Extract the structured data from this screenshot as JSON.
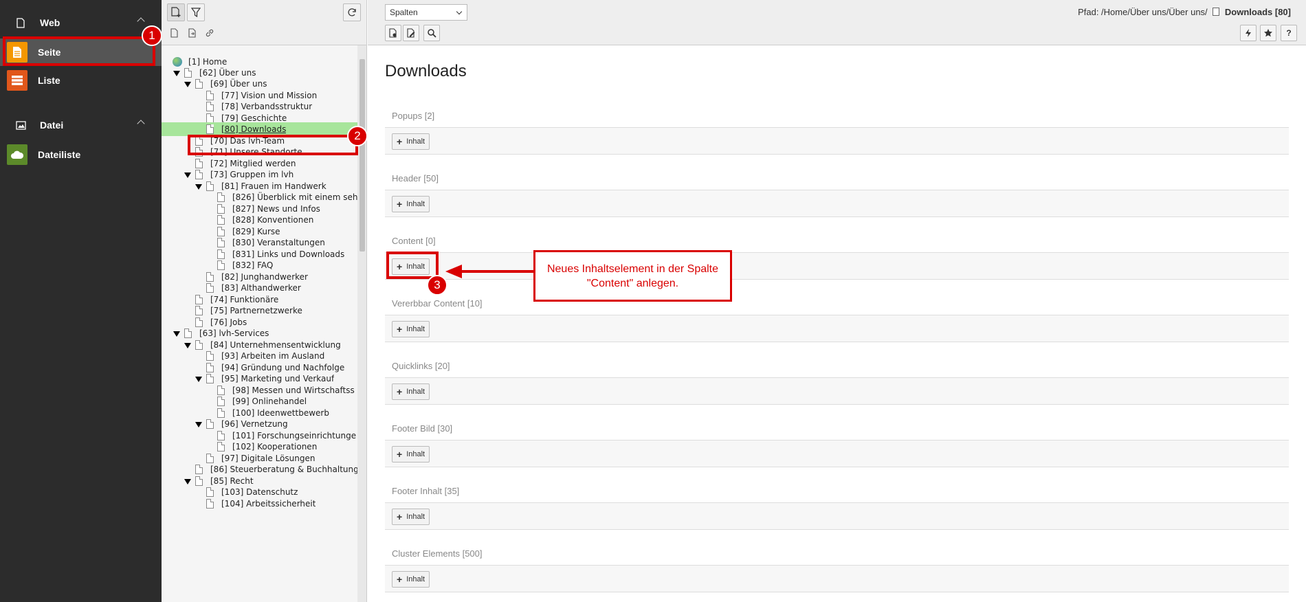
{
  "modmenu": {
    "groups": [
      {
        "label": "Web",
        "items": [
          {
            "label": "Seite"
          },
          {
            "label": "Liste"
          }
        ]
      },
      {
        "label": "Datei",
        "items": [
          {
            "label": "Dateiliste"
          }
        ]
      }
    ]
  },
  "tree": {
    "nodes": [
      {
        "label": "[1] Home"
      },
      {
        "label": "[62] Über uns"
      },
      {
        "label": "[69] Über uns"
      },
      {
        "label": "[77] Vision und Mission"
      },
      {
        "label": "[78] Verbandsstruktur"
      },
      {
        "label": "[79] Geschichte"
      },
      {
        "label": "[80] Downloads"
      },
      {
        "label": "[70] Das lvh-Team"
      },
      {
        "label": "[71] Unsere Standorte"
      },
      {
        "label": "[72] Mitglied werden"
      },
      {
        "label": "[73] Gruppen im lvh"
      },
      {
        "label": "[81] Frauen im Handwerk"
      },
      {
        "label": "[826] Überblick mit einem seh"
      },
      {
        "label": "[827] News und Infos"
      },
      {
        "label": "[828] Konventionen"
      },
      {
        "label": "[829] Kurse"
      },
      {
        "label": "[830] Veranstaltungen"
      },
      {
        "label": "[831] Links und Downloads"
      },
      {
        "label": "[832] FAQ"
      },
      {
        "label": "[82] Junghandwerker"
      },
      {
        "label": "[83] Althandwerker"
      },
      {
        "label": "[74] Funktionäre"
      },
      {
        "label": "[75] Partnernetzwerke"
      },
      {
        "label": "[76] Jobs"
      },
      {
        "label": "[63] lvh-Services"
      },
      {
        "label": "[84] Unternehmensentwicklung"
      },
      {
        "label": "[93] Arbeiten im Ausland"
      },
      {
        "label": "[94] Gründung und Nachfolge"
      },
      {
        "label": "[95] Marketing und Verkauf"
      },
      {
        "label": "[98] Messen und Wirtschaftss"
      },
      {
        "label": "[99] Onlinehandel"
      },
      {
        "label": "[100] Ideenwettbewerb"
      },
      {
        "label": "[96] Vernetzung"
      },
      {
        "label": "[101] Forschungseinrichtunge"
      },
      {
        "label": "[102] Kooperationen"
      },
      {
        "label": "[97] Digitale Lösungen"
      },
      {
        "label": "[86] Steuerberatung & Buchhaltung"
      },
      {
        "label": "[85] Recht"
      },
      {
        "label": "[103] Datenschutz"
      },
      {
        "label": "[104] Arbeitssicherheit"
      }
    ]
  },
  "header": {
    "column_select": "Spalten",
    "path_prefix": "Pfad: /Home/Über uns/Über uns/",
    "path_current": "Downloads [80]"
  },
  "main": {
    "title": "Downloads",
    "add_label": "Inhalt",
    "sections": [
      {
        "title": "Popups [2]"
      },
      {
        "title": "Header [50]"
      },
      {
        "title": "Content [0]"
      },
      {
        "title": "Vererbbar Content [10]"
      },
      {
        "title": "Quicklinks [20]"
      },
      {
        "title": "Footer Bild [30]"
      },
      {
        "title": "Footer Inhalt [35]"
      },
      {
        "title": "Cluster Elements [500]"
      }
    ]
  },
  "annotations": {
    "badges": [
      "1",
      "2",
      "3"
    ],
    "callout": "Neues Inhaltselement in der Spalte \"Content\" anlegen.",
    "color": "#d90000"
  }
}
